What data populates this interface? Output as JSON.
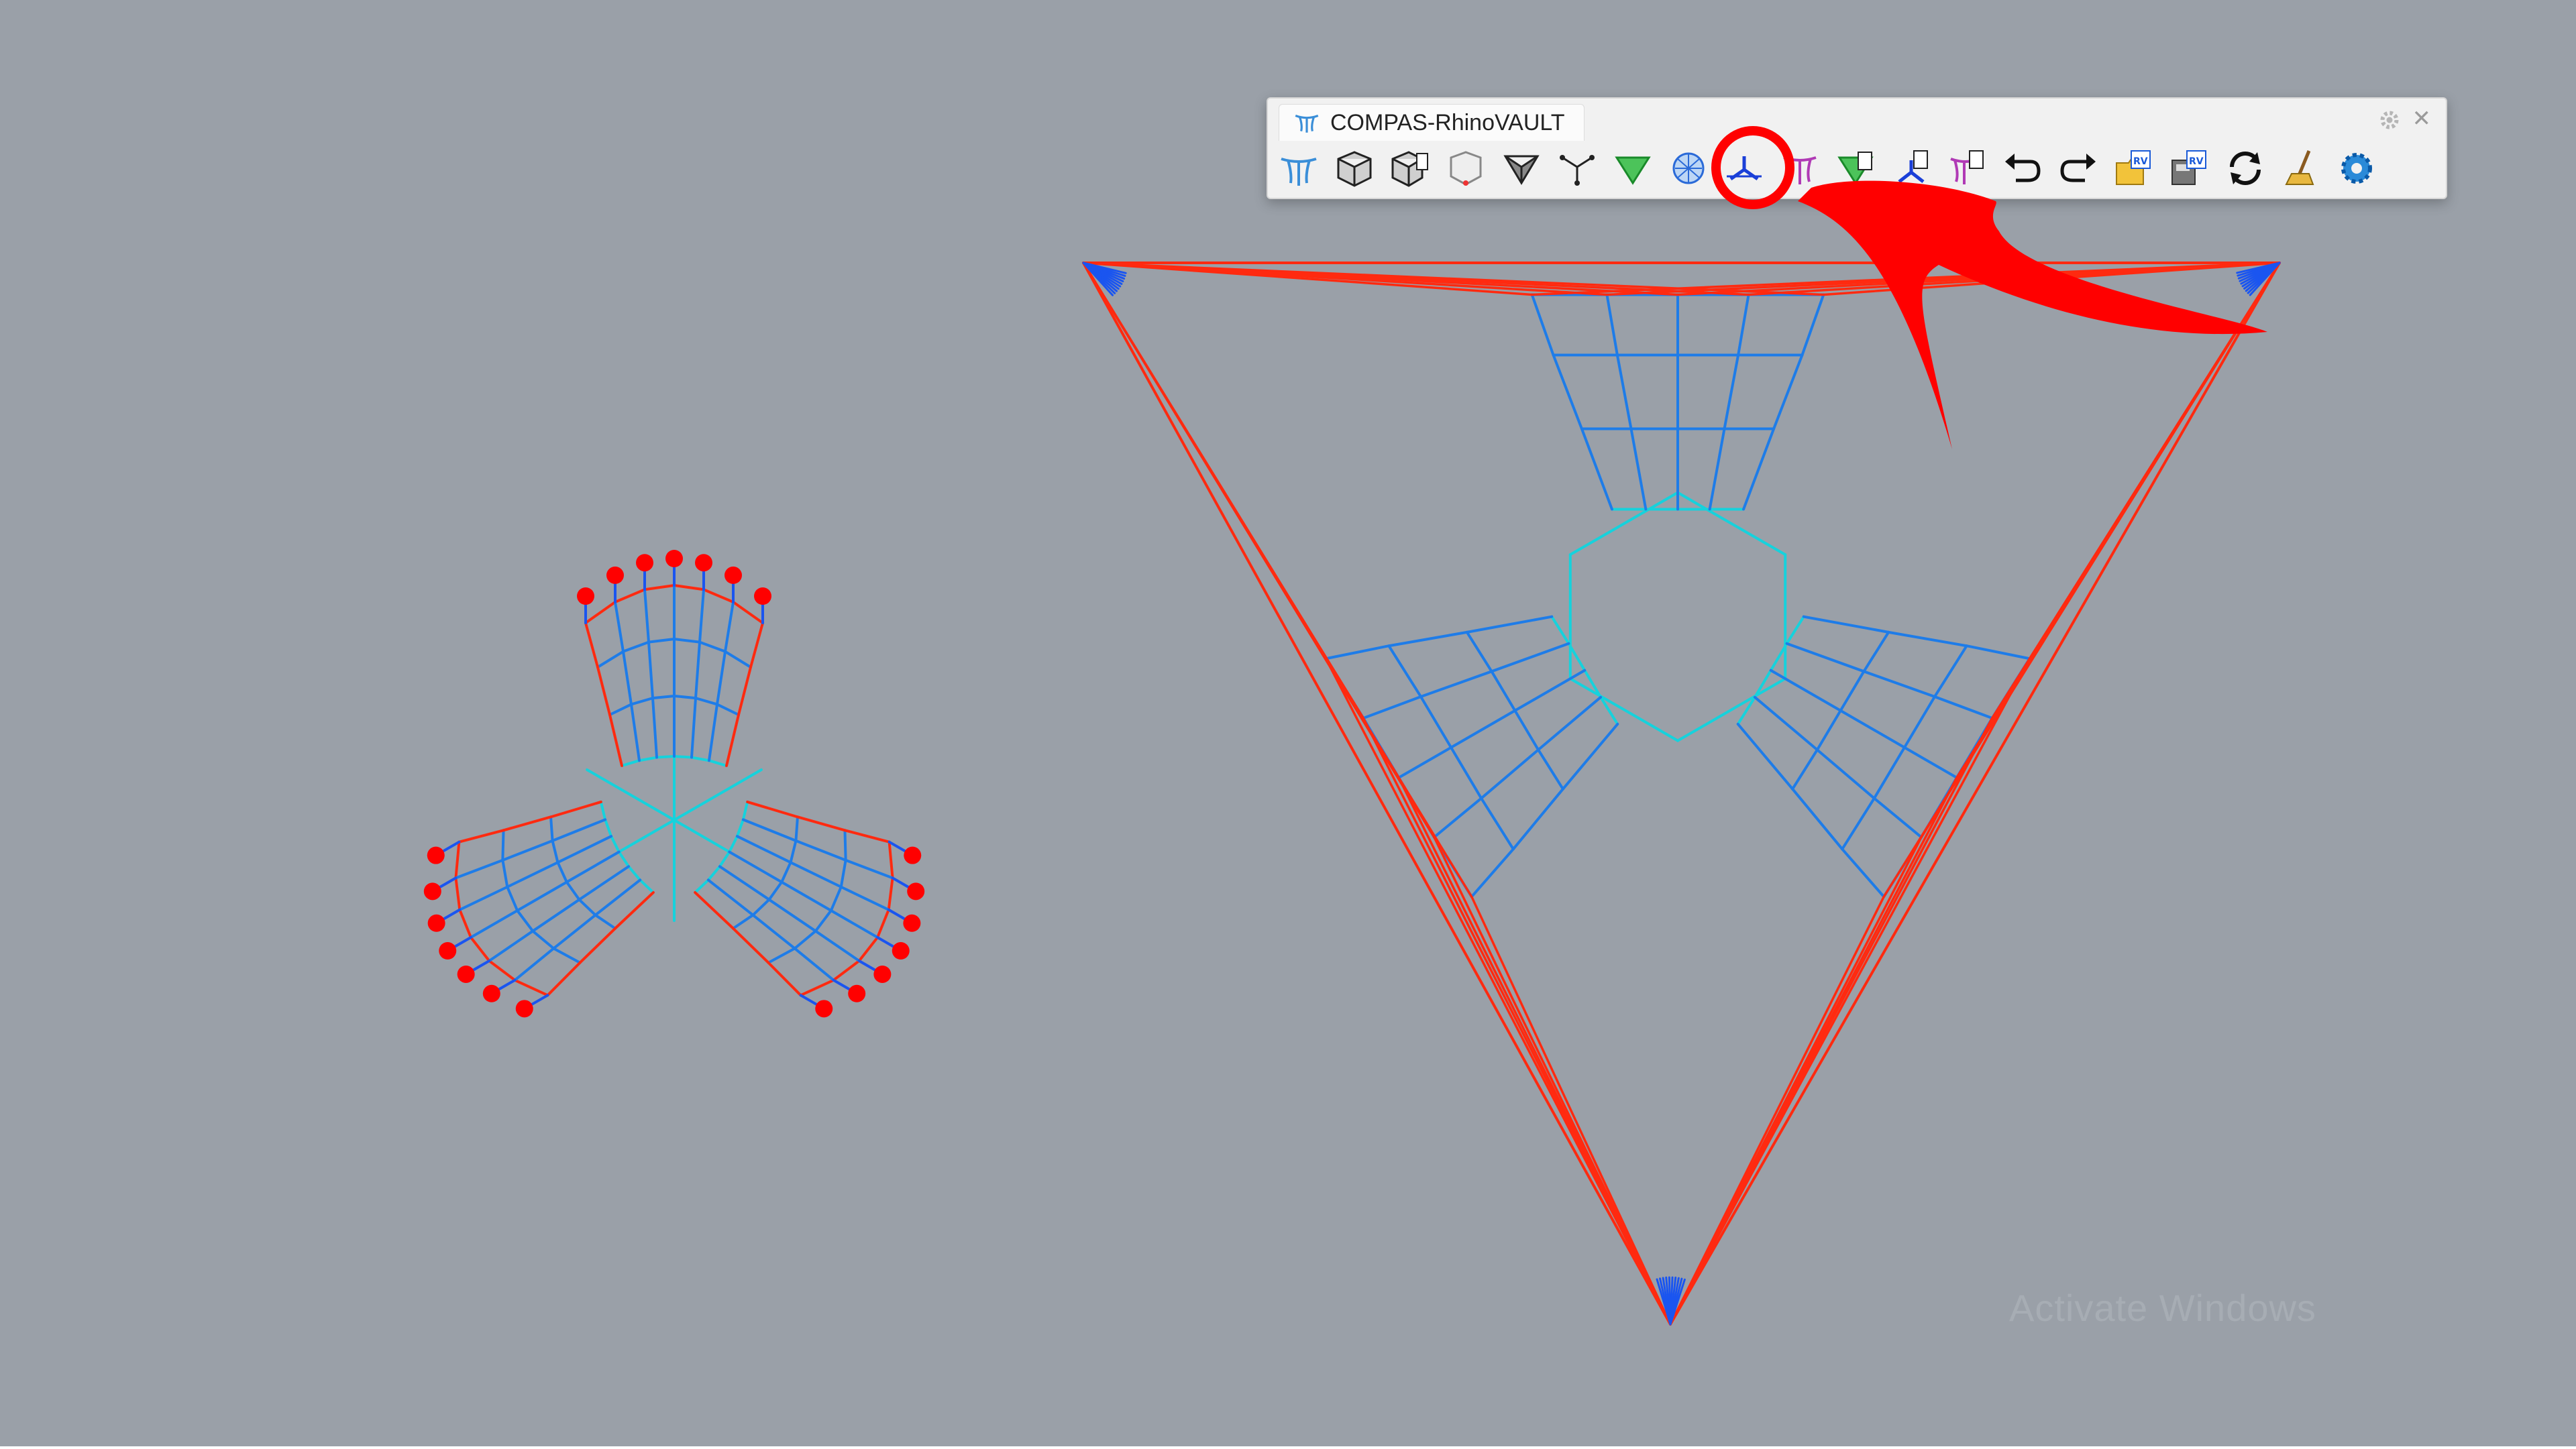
{
  "window": {
    "toolbar_title": "COMPAS-RhinoVAULT",
    "watermark": "Activate Windows"
  },
  "toolbar_buttons": [
    {
      "name": "rhinovault-icon"
    },
    {
      "name": "pattern-from-mesh-icon"
    },
    {
      "name": "pattern-from-surface-icon"
    },
    {
      "name": "pattern-relax-icon"
    },
    {
      "name": "boundaries-icon"
    },
    {
      "name": "form-diagram-icon"
    },
    {
      "name": "force-diagram-icon"
    },
    {
      "name": "mesh-sphere-icon"
    },
    {
      "name": "horizontal-equilibrium-icon",
      "highlighted": true
    },
    {
      "name": "vertical-equilibrium-icon"
    },
    {
      "name": "modify-form-icon"
    },
    {
      "name": "modify-force-icon"
    },
    {
      "name": "modify-thrust-icon"
    },
    {
      "name": "undo-icon"
    },
    {
      "name": "redo-icon"
    },
    {
      "name": "open-session-icon"
    },
    {
      "name": "save-session-icon"
    },
    {
      "name": "reload-icon"
    },
    {
      "name": "clear-icon"
    },
    {
      "name": "settings-gear-icon"
    }
  ],
  "colors": {
    "background": "#9aa0a8",
    "edge_red": "#ff2a10",
    "edge_blue": "#1a55f0",
    "edge_mid": "#1e7ce8",
    "edge_cyan": "#16d2dc",
    "support_dot": "#ff0000",
    "annotation": "#ff0000"
  }
}
